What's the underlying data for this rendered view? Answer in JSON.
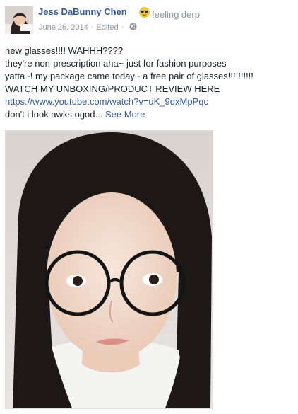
{
  "post": {
    "author": "Jess DaBunny Chen",
    "feeling_emoji": "sunglasses-emoji-icon",
    "feeling": "feeling derp",
    "date": "June 26, 2014",
    "separator": "·",
    "edited": "Edited",
    "privacy_icon": "globe-icon",
    "lines": [
      "new glasses!!!! WAHHH????",
      "they're non-prescription aha~ just for fashion purposes",
      "yatta~! my package came today~ a free pair of glasses!!!!!!!!!!",
      "WATCH MY UNBOXING/PRODUCT REVIEW HERE"
    ],
    "link": "https://www.youtube.com/watch?v=uK_9qxMpPqc",
    "last_line": "don't i look awks ogod...",
    "see_more": "See More"
  },
  "colors": {
    "link_blue": "#365899",
    "meta_gray": "#90949c",
    "text": "#1d2129"
  }
}
